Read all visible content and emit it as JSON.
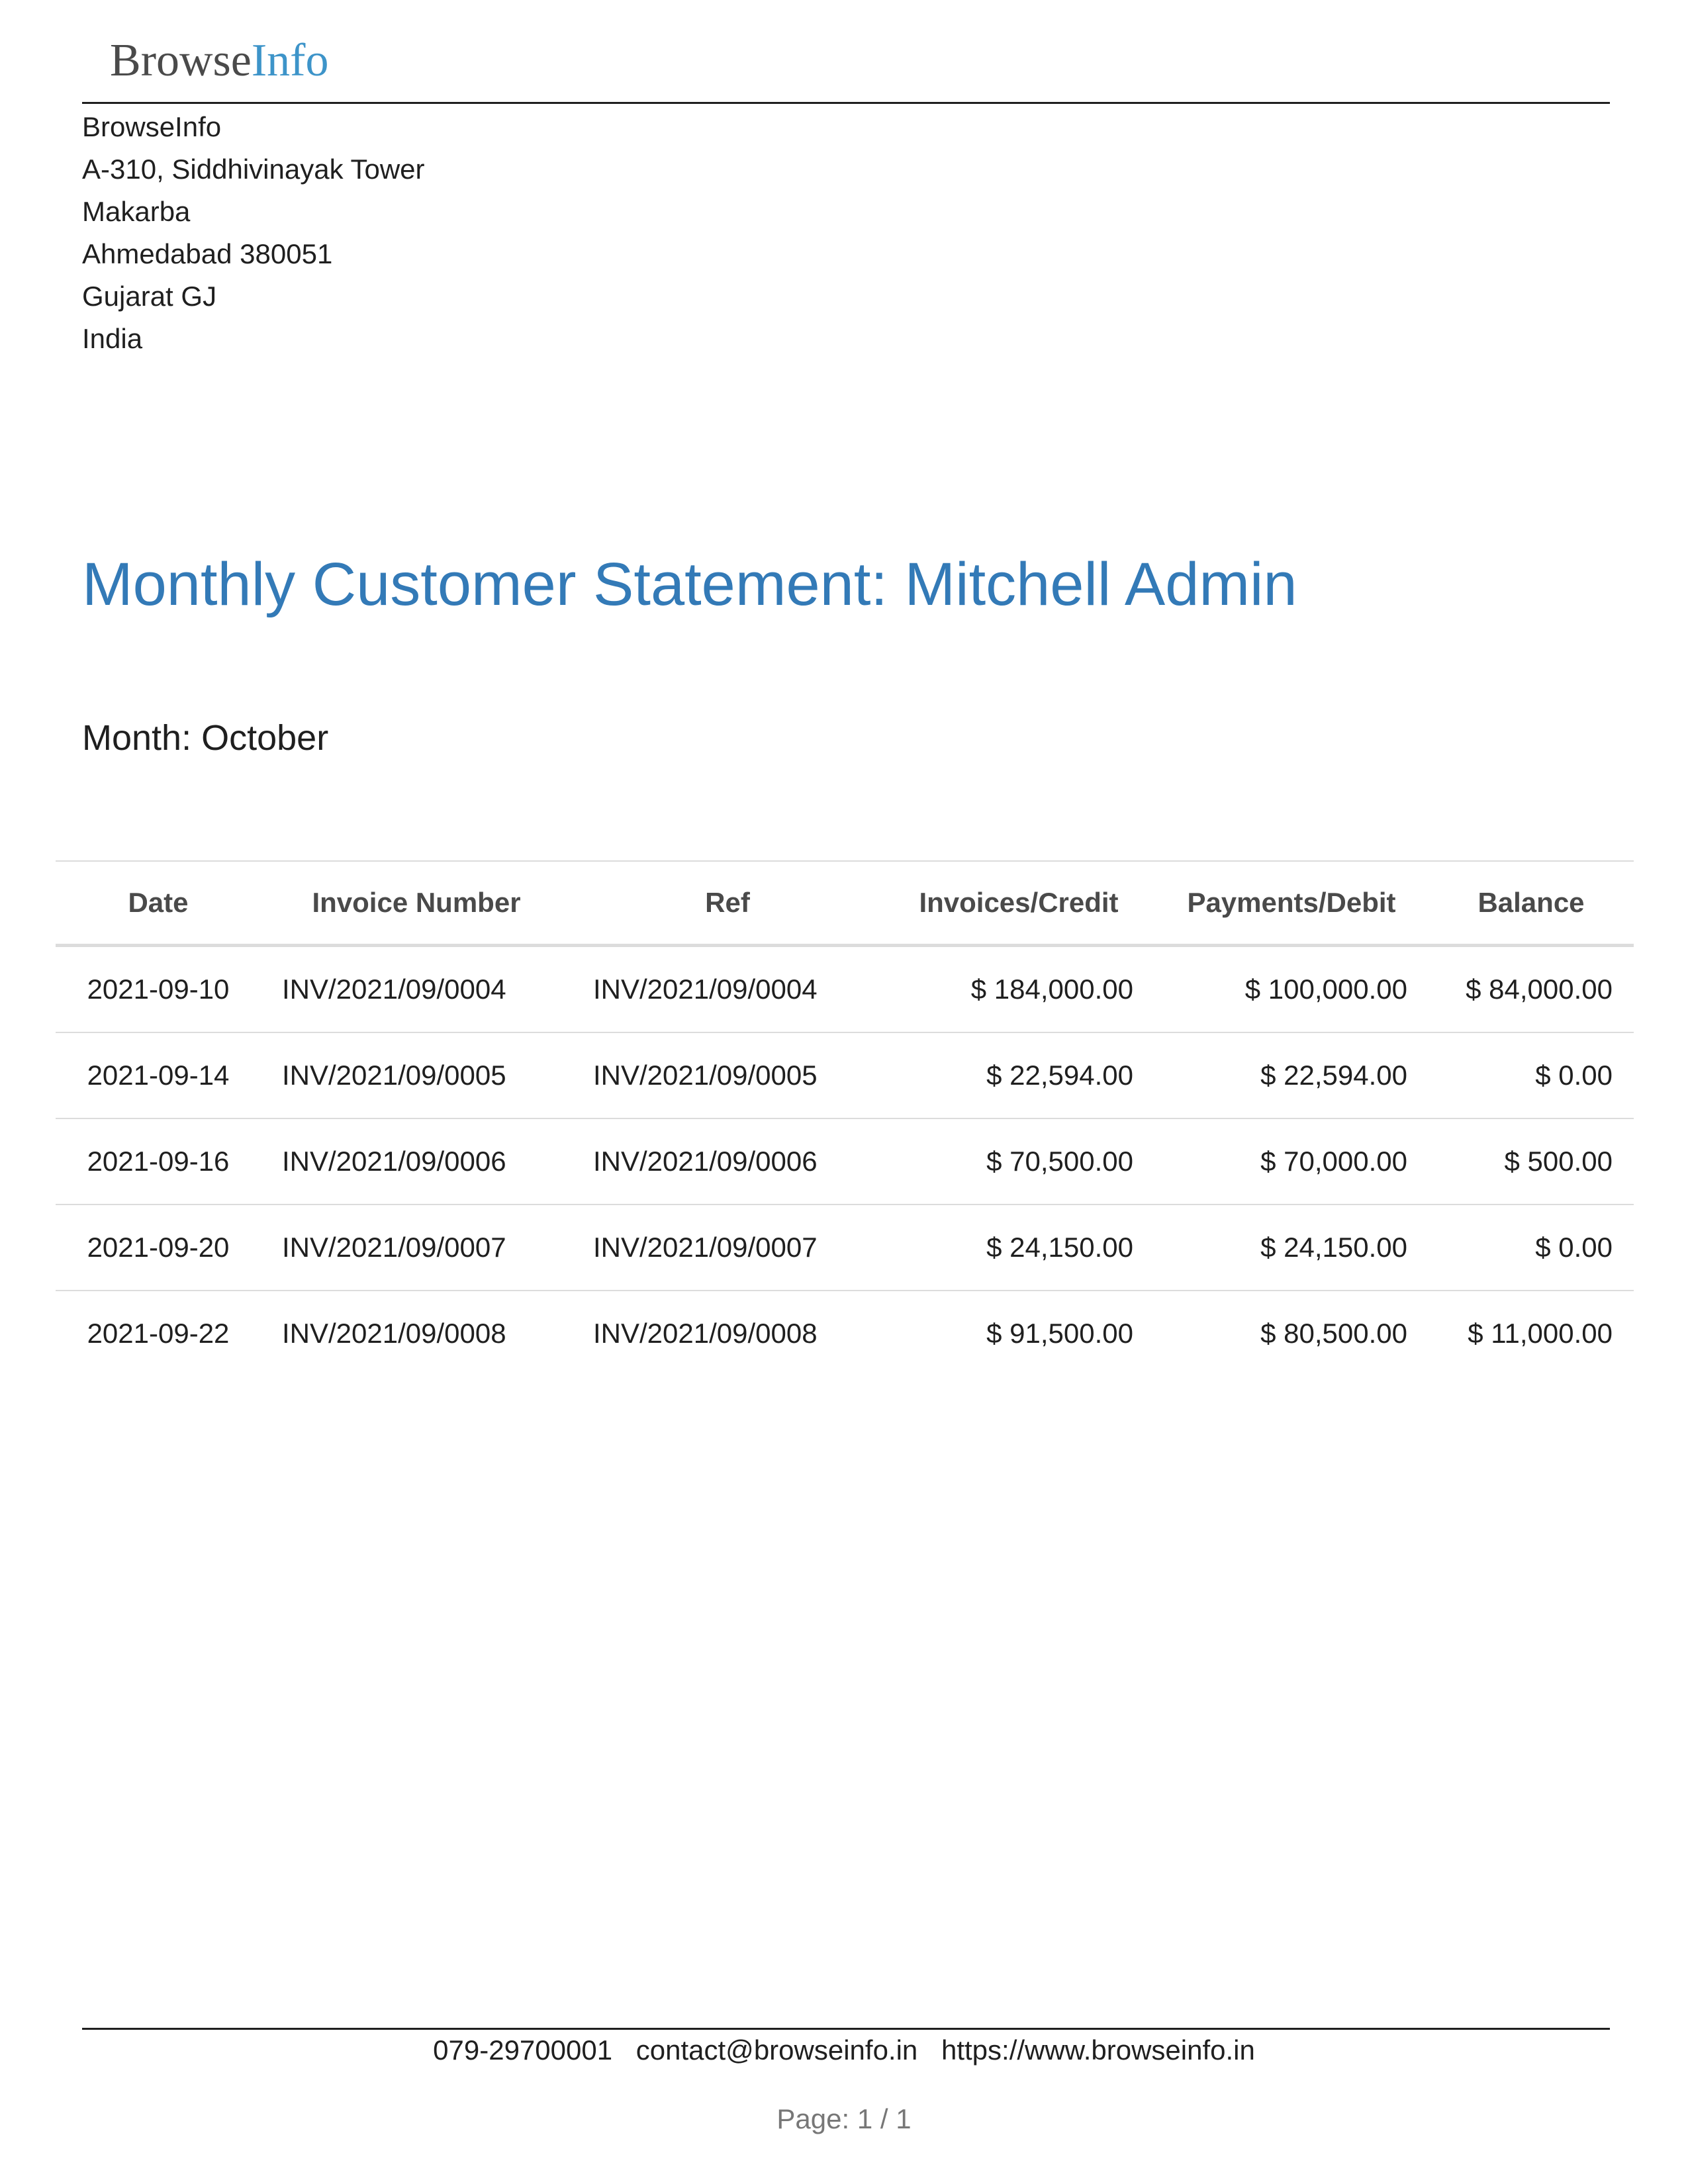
{
  "logo": {
    "part_1": "Browse",
    "part_2": "Info"
  },
  "company_address": {
    "lines": [
      "BrowseInfo",
      "A-310, Siddhivinayak Tower",
      "Makarba",
      "Ahmedabad 380051",
      "Gujarat GJ",
      "India"
    ]
  },
  "document": {
    "title": "Monthly Customer Statement: Mitchell Admin",
    "month_line": "Month: October"
  },
  "table": {
    "headers": {
      "date": "Date",
      "invoice_number": "Invoice Number",
      "ref": "Ref",
      "invoices_credit": "Invoices/Credit",
      "payments_debit": "Payments/Debit",
      "balance": "Balance"
    },
    "rows": [
      {
        "date": "2021-09-10",
        "invoice_number": "INV/2021/09/0004",
        "ref": "INV/2021/09/0004",
        "invoices_credit": "$ 184,000.00",
        "payments_debit": "$ 100,000.00",
        "balance": "$ 84,000.00"
      },
      {
        "date": "2021-09-14",
        "invoice_number": "INV/2021/09/0005",
        "ref": "INV/2021/09/0005",
        "invoices_credit": "$ 22,594.00",
        "payments_debit": "$ 22,594.00",
        "balance": "$ 0.00"
      },
      {
        "date": "2021-09-16",
        "invoice_number": "INV/2021/09/0006",
        "ref": "INV/2021/09/0006",
        "invoices_credit": "$ 70,500.00",
        "payments_debit": "$ 70,000.00",
        "balance": "$ 500.00"
      },
      {
        "date": "2021-09-20",
        "invoice_number": "INV/2021/09/0007",
        "ref": "INV/2021/09/0007",
        "invoices_credit": "$ 24,150.00",
        "payments_debit": "$ 24,150.00",
        "balance": "$ 0.00"
      },
      {
        "date": "2021-09-22",
        "invoice_number": "INV/2021/09/0008",
        "ref": "INV/2021/09/0008",
        "invoices_credit": "$ 91,500.00",
        "payments_debit": "$ 80,500.00",
        "balance": "$ 11,000.00"
      }
    ]
  },
  "footer": {
    "phone": "079-29700001",
    "email": "contact@browseinfo.in",
    "website": "https://www.browseinfo.in",
    "page_counter": "Page: 1 / 1"
  },
  "colors": {
    "title_blue": "#337ab7",
    "logo_blue": "#3d94c9",
    "logo_gray": "#4a4a4a",
    "rule_dark": "#1f1f1f",
    "table_border": "#dcdcdc",
    "page_counter_gray": "#777777"
  }
}
